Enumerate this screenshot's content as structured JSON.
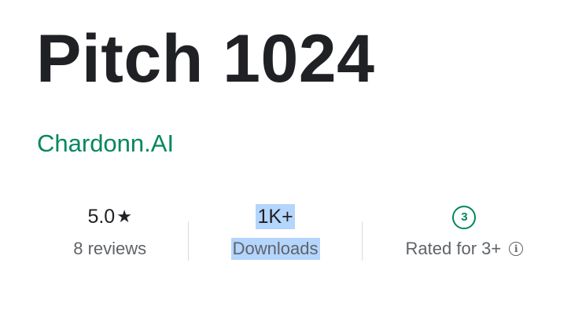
{
  "app": {
    "title": "Pitch 1024",
    "developer": "Chardonn.AI"
  },
  "stats": {
    "rating": {
      "value": "5.0",
      "label": "8 reviews",
      "icon": "star-icon"
    },
    "downloads": {
      "value": "1K+",
      "label": "Downloads"
    },
    "content_rating": {
      "badge": "3",
      "label": "Rated for 3+",
      "icon": "info-icon"
    }
  },
  "colors": {
    "developer": "#01875f",
    "title": "#202124",
    "secondary_text": "#5f6368",
    "selection_highlight": "#b4d5fc",
    "divider": "#dadce0"
  }
}
